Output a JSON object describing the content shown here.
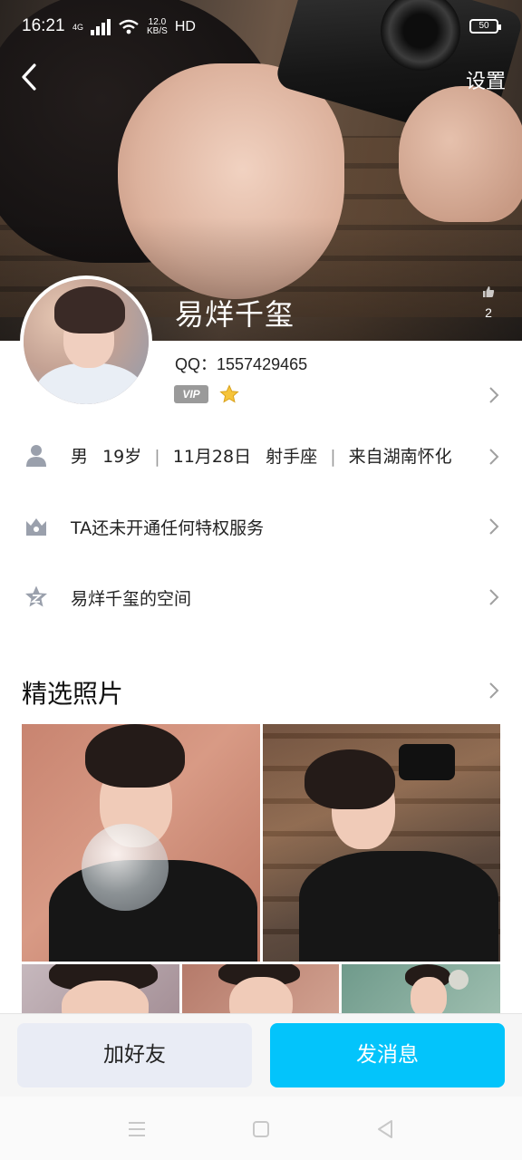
{
  "status_bar": {
    "time": "16:21",
    "network": "4G",
    "speed_value": "12.0",
    "speed_unit": "KB/S",
    "hd": "HD",
    "battery": "50"
  },
  "header": {
    "settings_label": "设置",
    "nickname": "易烊千玺",
    "like_count": "2"
  },
  "profile": {
    "qq_label": "QQ：",
    "qq_number": "1557429465",
    "vip_badge": "VIP"
  },
  "info_rows": {
    "basic": {
      "gender": "男",
      "age": "19岁",
      "birthday": "11月28日",
      "zodiac": "射手座",
      "hometown": "来自湖南怀化"
    },
    "privilege": "TA还未开通任何特权服务",
    "space": "易烊千玺的空间"
  },
  "photos_section": {
    "title": "精选照片"
  },
  "actions": {
    "add_friend": "加好友",
    "send_message": "发消息"
  },
  "colors": {
    "accent": "#03c4fb",
    "secondary_button": "#e9ecf5",
    "icon_gray": "#9aa0ac"
  }
}
